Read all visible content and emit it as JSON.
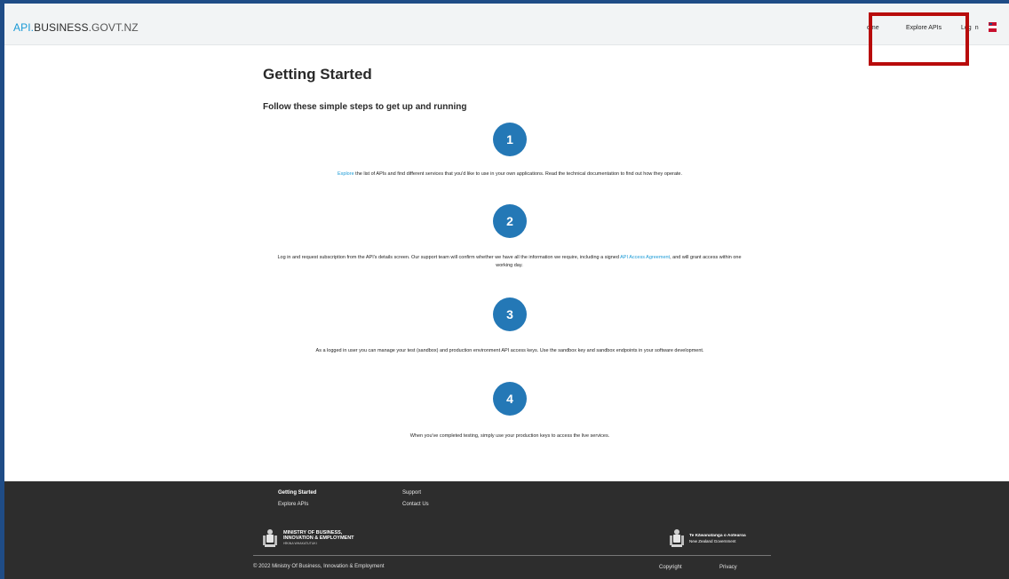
{
  "header": {
    "logo_api": "API",
    "logo_dot": ".",
    "logo_business": "BUSINESS",
    "logo_govt": ".GOVT.NZ",
    "nav": {
      "home": "ome",
      "explore": "Explore APIs",
      "login": "Log",
      "login_tail": "n"
    }
  },
  "main": {
    "title": "Getting Started",
    "subtitle": "Follow these simple steps to get up and running",
    "steps": [
      {
        "number": "1",
        "link": "Explore",
        "text": " the list of APIs and find different services that you'd like to use in your own applications. Read the technical documentation to find out how they operate."
      },
      {
        "number": "2",
        "text_before": "Log in and request subscription from the API's details screen. Our support team will confirm whether we have all the information we require, including a signed ",
        "link": "API Access Agreement",
        "text_after": ", and will grant access within one working day."
      },
      {
        "number": "3",
        "text": "As a logged in user you can manage your test (sandbox) and production environment API access keys. Use the sandbox key and sandbox endpoints in your software development."
      },
      {
        "number": "4",
        "text": "When you've completed testing, simply use your production keys to access the live services."
      }
    ]
  },
  "footer": {
    "links": {
      "getting_started": "Getting Started",
      "explore_apis": "Explore APIs",
      "support": "Support",
      "contact_us": "Contact Us"
    },
    "mbie_line1": "MINISTRY OF BUSINESS,",
    "mbie_line2": "INNOVATION & EMPLOYMENT",
    "mbie_line3": "HĪKINA WHAKATUTUKI",
    "nzgov_line1": "Te Kāwanatanga o Aotearoa",
    "nzgov_line2": "New Zealand Government",
    "copyright_notice": "© 2022 Ministry Of Business, Innovation & Employment",
    "copyright_link": "Copyright",
    "privacy_link": "Privacy"
  },
  "colors": {
    "accent": "#1a9ad6",
    "step_circle": "#2478b6",
    "footer_bg": "#2d2d2d",
    "highlight_box": "#b80b0b",
    "window_border": "#1f4c86"
  }
}
